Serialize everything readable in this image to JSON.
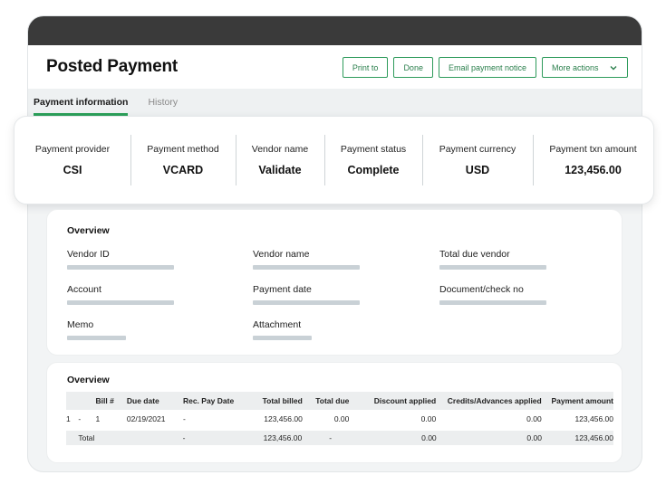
{
  "header": {
    "title": "Posted Payment",
    "actions": {
      "print": "Print to",
      "done": "Done",
      "email": "Email payment notice",
      "more": "More actions"
    }
  },
  "tabs": [
    {
      "label": "Payment information",
      "active": true
    },
    {
      "label": "History",
      "active": false
    }
  ],
  "summary": [
    {
      "label": "Payment provider",
      "value": "CSI"
    },
    {
      "label": "Payment method",
      "value": "VCARD"
    },
    {
      "label": "Vendor name",
      "value": "Validate"
    },
    {
      "label": "Payment status",
      "value": "Complete"
    },
    {
      "label": "Payment currency",
      "value": "USD"
    },
    {
      "label": "Payment txn amount",
      "value": "123,456.00"
    }
  ],
  "overview": {
    "title": "Overview",
    "fields": {
      "vendor_id": "Vendor ID",
      "vendor_name": "Vendor name",
      "total_due_vendor": "Total due vendor",
      "account": "Account",
      "payment_date": "Payment date",
      "document_check_no": "Document/check no",
      "memo": "Memo",
      "attachment": "Attachment"
    }
  },
  "bills": {
    "title": "Overview",
    "columns": {
      "bill": "Bill #",
      "due_date": "Due date",
      "rec_pay_date": "Rec. Pay Date",
      "total_billed": "Total billed",
      "total_due": "Total due",
      "discount": "Discount applied",
      "credits": "Credits/Advances applied",
      "payment_amount": "Payment amount"
    },
    "rows": [
      {
        "index": "1",
        "dash": "-",
        "bill": "1",
        "due_date": "02/19/2021",
        "rec_pay_date": "-",
        "total_billed": "123,456.00",
        "total_due": "0.00",
        "discount": "0.00",
        "credits": "0.00",
        "payment_amount": "123,456.00"
      }
    ],
    "total": {
      "label": "Total",
      "rec_pay_date": "-",
      "total_billed": "123,456.00",
      "total_due": "-",
      "discount": "0.00",
      "credits": "0.00",
      "payment_amount": "123,456.00"
    }
  },
  "colors": {
    "accent": "#2ca05a",
    "topbar": "#3a3a3a",
    "placeholder_bar": "#c9d1d6"
  }
}
